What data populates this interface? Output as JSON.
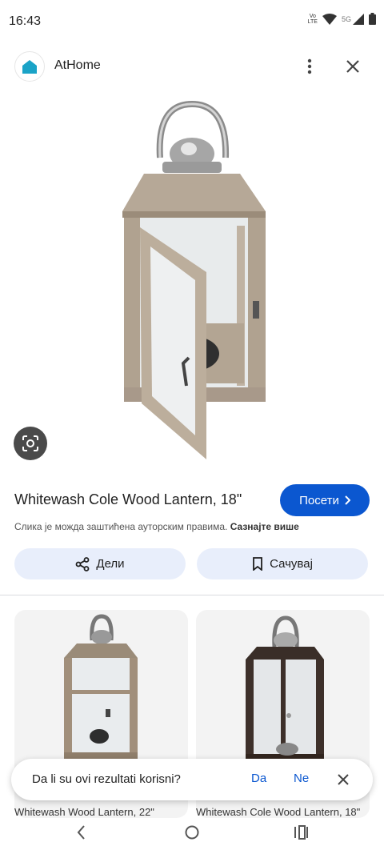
{
  "status_bar": {
    "time": "16:43",
    "volte_top": "Vo",
    "volte_bottom": "LTE",
    "network": "5G"
  },
  "header": {
    "site_name": "AtHome"
  },
  "result": {
    "title": "Whitewash Cole Wood Lantern, 18\"",
    "visit_label": "Посети",
    "copyright_text": "Слика је можда заштићена ауторским правима.",
    "learn_more": "Сазнајте више",
    "share_label": "Дели",
    "save_label": "Сачувај"
  },
  "related": [
    {
      "title": "Whitewash Wood Lantern, 22\""
    },
    {
      "title": "Whitewash Cole Wood Lantern, 18\""
    }
  ],
  "feedback": {
    "question": "Da li su ovi rezultati korisni?",
    "yes": "Da",
    "no": "Ne"
  },
  "colors": {
    "accent": "#0b57d0",
    "chip_bg": "#e8eefb",
    "logo": "#1aa3c7"
  }
}
